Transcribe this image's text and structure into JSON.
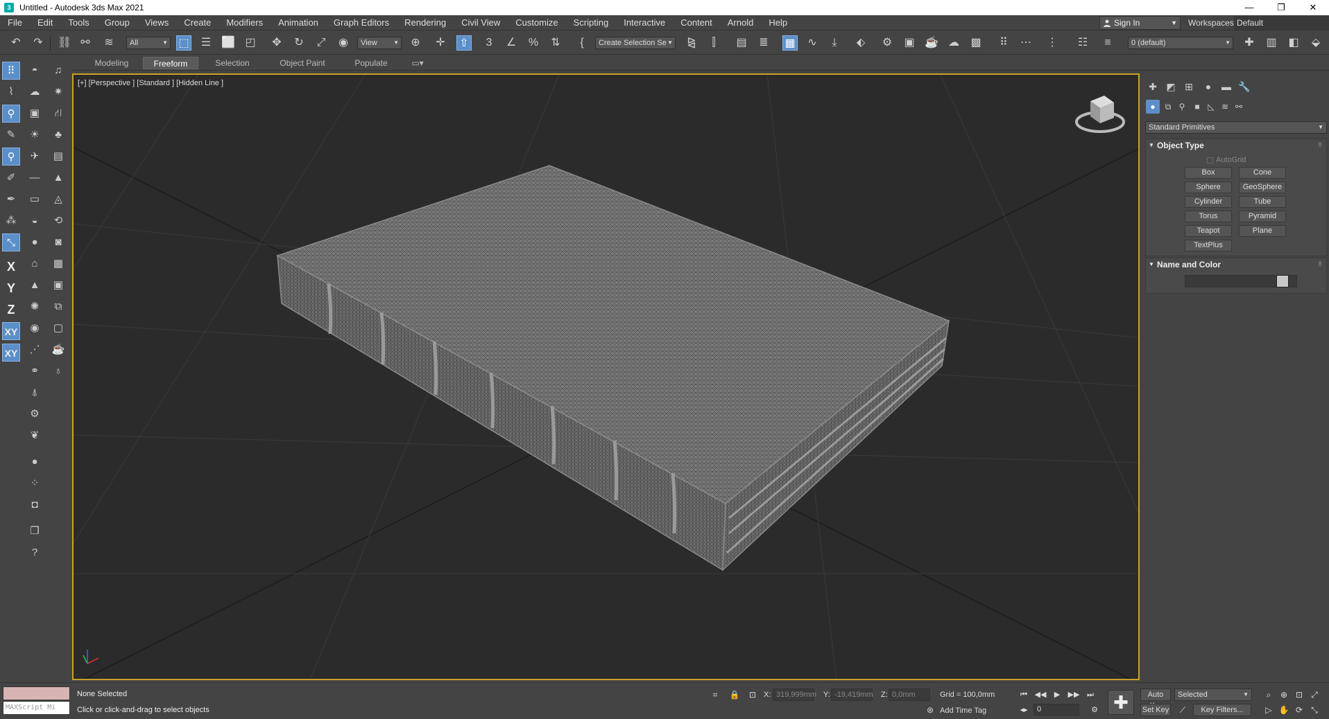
{
  "window": {
    "title": "Untitled - Autodesk 3ds Max 2021",
    "minimize": "—",
    "restore": "❐",
    "close": "✕"
  },
  "menu": [
    "File",
    "Edit",
    "Tools",
    "Group",
    "Views",
    "Create",
    "Modifiers",
    "Animation",
    "Graph Editors",
    "Rendering",
    "Civil View",
    "Customize",
    "Scripting",
    "Interactive",
    "Content",
    "Arnold",
    "Help"
  ],
  "account": {
    "signin_label": "Sign In",
    "workspaces_label": "Workspaces:",
    "workspaces_value": "Default"
  },
  "toolbar": {
    "selection_filter": "All",
    "reference_coord": "View",
    "named_selection": "Create Selection Se",
    "layer": "0 (default)"
  },
  "ribbon": {
    "tabs": [
      "Modeling",
      "Freeform",
      "Selection",
      "Object Paint",
      "Populate"
    ],
    "active_tab": "Freeform"
  },
  "left_axis": {
    "x": "X",
    "y": "Y",
    "z": "Z",
    "xy": "XY",
    "xy2": "XY"
  },
  "viewport": {
    "label": "[+] [Perspective ] [Standard ] [Hidden Line ]"
  },
  "command_panel": {
    "category": "Standard Primitives",
    "object_type": {
      "title": "Object Type",
      "autogrid": "AutoGrid",
      "buttons": [
        "Box",
        "Cone",
        "Sphere",
        "GeoSphere",
        "Cylinder",
        "Tube",
        "Torus",
        "Pyramid",
        "Teapot",
        "Plane",
        "TextPlus"
      ]
    },
    "name_and_color": {
      "title": "Name and Color"
    }
  },
  "status": {
    "maxscript_placeholder": "MAXScript Mi",
    "selection": "None Selected",
    "prompt": "Click or click-and-drag to select objects",
    "x_label": "X:",
    "x_value": "319,999mm",
    "y_label": "Y:",
    "y_value": "-19,419mm",
    "z_label": "Z:",
    "z_value": "0,0mm",
    "grid": "Grid = 100,0mm",
    "add_time_tag": "Add Time Tag",
    "frame": "0",
    "auto_key": "Auto K...",
    "set_key": "Set Key",
    "key_mode": "Selected",
    "key_filters": "Key Filters..."
  },
  "colors": {
    "active_blue": "#5b8fc9",
    "viewport_border": "#c9a227",
    "viewport_bg": "#2b2b2b",
    "wireframe": "#8a8a8a"
  }
}
